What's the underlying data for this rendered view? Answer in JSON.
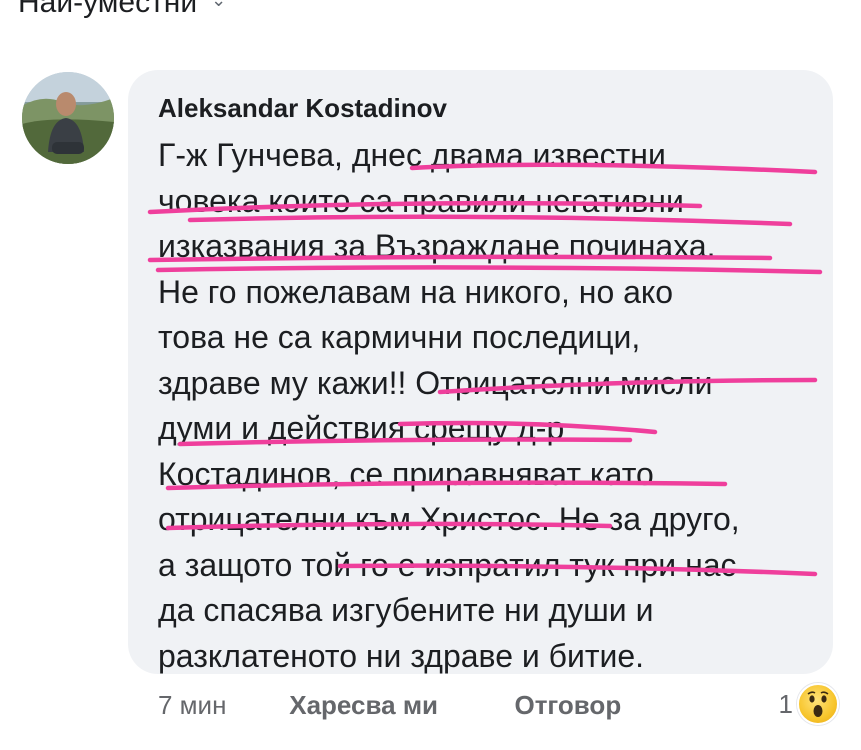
{
  "sort_label": "Най-уместни",
  "comment": {
    "author": "Aleksandar Kostadinov",
    "lines": [
      "Г-ж Гунчева, днес двама известни",
      "човека които са правили негативни",
      "изказвания за Възраждане починаха.",
      "Не го пожелавам на никого, но ако",
      "това не са кармични последици,",
      "здраве му кажи!! Отрицателни мисли",
      "думи и действия срещу д-р",
      "Костадинов, се приравняват като",
      "отрицателни към Христос. Не за друго,",
      "а защото той го е изпратил тук при нас",
      "да спасява изгубените ни души и",
      "разклатеното ни здраве и битие."
    ],
    "highlight_color": "#ef3f9c"
  },
  "actions": {
    "time": "7 мин",
    "like": "Харесва ми",
    "reply": "Отговор"
  },
  "reactions": {
    "count": "1",
    "icon": "wow-face-icon"
  },
  "colors": {
    "bubble": "#f0f2f5",
    "secondary_text": "#65676b"
  }
}
